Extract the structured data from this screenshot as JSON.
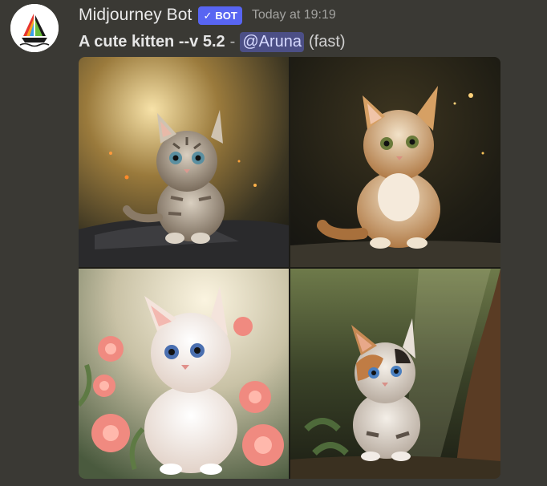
{
  "message": {
    "author": "Midjourney Bot",
    "badge": "BOT",
    "timestamp": "Today at 19:19",
    "prompt": "A cute kitten --v 5.2",
    "separator": "-",
    "mention": "@Aruna",
    "speed": "(fast)"
  },
  "icons": {
    "avatar": "midjourney-sailboat-logo",
    "badge_check": "checkmark-icon"
  },
  "colors": {
    "background": "#3a3934",
    "badge": "#5865f2",
    "mention_bg": "#4c4f86"
  }
}
